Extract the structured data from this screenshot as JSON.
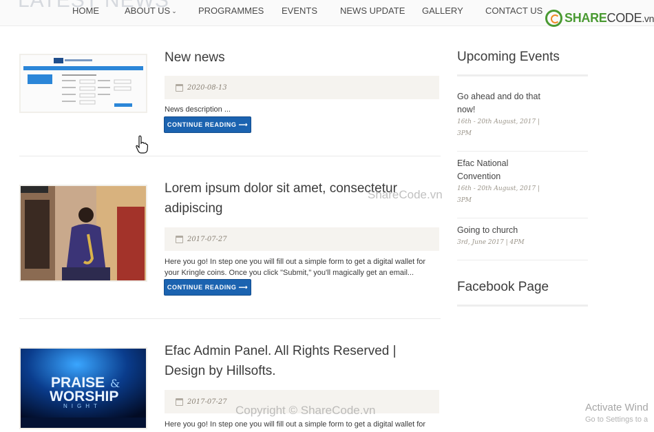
{
  "header": {
    "ghost_heading": "LATEST NEWS",
    "nav": [
      {
        "label": "HOME"
      },
      {
        "label": "ABOUT US"
      },
      {
        "label": "PROGRAMMES"
      },
      {
        "label": "EVENTS"
      },
      {
        "label": "NEWS UPDATE"
      },
      {
        "label": "GALLERY"
      },
      {
        "label": "CONTACT US"
      }
    ],
    "logo": {
      "part1": "SHARE",
      "part2": "CODE",
      "part3": ".vn"
    }
  },
  "news": [
    {
      "title": "New news",
      "date": "2020-08-13",
      "description": "News description ...",
      "button": "CONTINUE READING ⟶"
    },
    {
      "title": "Lorem ipsum dolor sit amet, consectetur adipiscing",
      "date": "2017-07-27",
      "description": "Here you go! In step one you will fill out a simple form to get a digital wallet for your Kringle coins. Once you click \"Submit,\" you'll magically get an email...",
      "button": "CONTINUE READING ⟶"
    },
    {
      "title": "Efac Admin Panel. All Rights Reserved | Design by Hillsofts.",
      "date": "2017-07-27",
      "description": "Here you go! In step one you will fill out a simple form to get a digital wallet for",
      "thumb_text": {
        "line1": "PRAISE",
        "amp": "&",
        "line2": "WORSHIP",
        "line3": "NIGHT"
      }
    }
  ],
  "sidebar": {
    "events_heading": "Upcoming Events",
    "events": [
      {
        "title": "Go ahead and do that now!",
        "date": "16th - 20th August, 2017 | 3PM"
      },
      {
        "title": "Efac National Convention",
        "date": "16th - 20th August, 2017 | 3PM"
      },
      {
        "title": "Going to church",
        "date": "3rd, June 2017 | 4PM"
      }
    ],
    "facebook_heading": "Facebook Page"
  },
  "overlays": {
    "watermark_center": "ShareCode.vn",
    "watermark_bottom": "Copyright © ShareCode.vn",
    "activate_title": "Activate Wind",
    "activate_sub": "Go to Settings to a"
  },
  "colors": {
    "button": "#1b63b0",
    "logo_green": "#4a9a32",
    "meta_bg": "#f5f3ef"
  }
}
